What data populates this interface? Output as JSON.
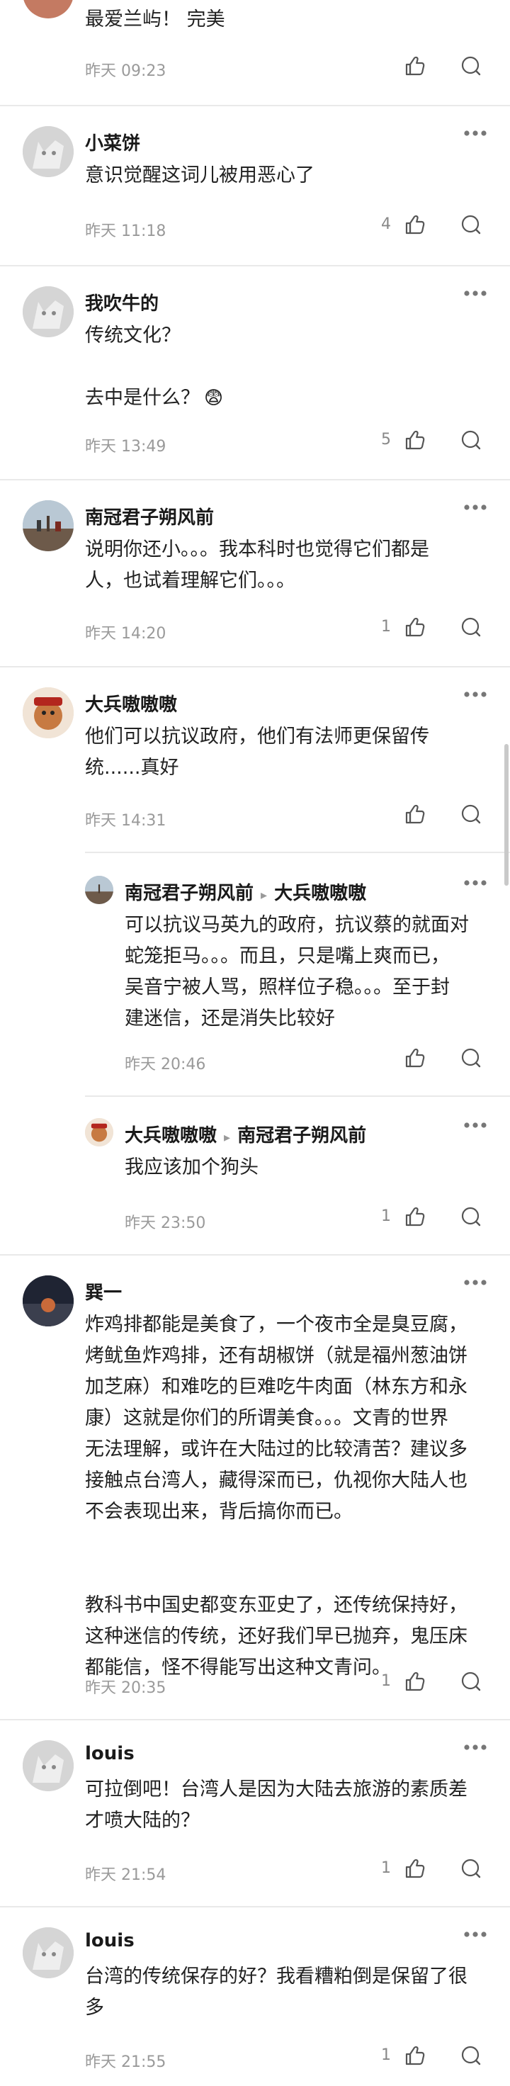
{
  "comments": [
    {
      "id": "c0",
      "user": "",
      "text": "最爱兰屿！ 完美",
      "time": "昨天 09:23",
      "likes": ""
    },
    {
      "id": "c1",
      "user": "小菜饼",
      "text": "意识觉醒这词儿被用恶心了",
      "time": "昨天 11:18",
      "likes": "4"
    },
    {
      "id": "c2",
      "user": "我吹牛的",
      "text": "传统文化？\n\n去中是什么？",
      "emoji": "😨",
      "time": "昨天 13:49",
      "likes": "5"
    },
    {
      "id": "c3",
      "user": "南冠君子朔风前",
      "text": "说明你还小。。。我本科时也觉得它们都是\n人，也试着理解它们。。。",
      "time": "昨天 14:20",
      "likes": "1"
    },
    {
      "id": "c4",
      "user": "大兵嗷嗷嗷",
      "text": "他们可以抗议政府，他们有法师更保留传\n统......真好",
      "time": "昨天 14:31",
      "likes": ""
    },
    {
      "id": "r1",
      "user": "南冠君子朔风前",
      "reply_to": "大兵嗷嗷嗷",
      "text": "可以抗议马英九的政府，抗议蔡的就面对\n蛇笼拒马。。。而且，只是嘴上爽而已，\n吴音宁被人骂，照样位子稳。。。至于封\n建迷信，还是消失比较好",
      "time": "昨天 20:46",
      "likes": ""
    },
    {
      "id": "r2",
      "user": "大兵嗷嗷嗷",
      "reply_to": "南冠君子朔风前",
      "text": "我应该加个狗头",
      "time": "昨天 23:50",
      "likes": "1"
    },
    {
      "id": "c5",
      "user": "巽一",
      "text": "炸鸡排都能是美食了，一个夜市全是臭豆腐，\n烤鱿鱼炸鸡排，还有胡椒饼（就是福州葱油饼\n加芝麻）和难吃的巨难吃牛肉面（林东方和永\n康）这就是你们的所谓美食。。。文青的世界\n无法理解，或许在大陆过的比较清苦？建议多\n接触点台湾人，藏得深而已，仇视你大陆人也\n不会表现出来，背后搞你而已。\n\n\n教科书中国史都变东亚史了，还传统保持好，\n这种迷信的传统，还好我们早已抛弃，鬼压床\n都能信，怪不得能写出这种文青问。",
      "time": "昨天 20:35",
      "likes": "1"
    },
    {
      "id": "c6",
      "user": "louis",
      "text": "可拉倒吧！台湾人是因为大陆去旅游的素质差\n才喷大陆的？",
      "time": "昨天 21:54",
      "likes": "1"
    },
    {
      "id": "c7",
      "user": "louis",
      "text": "台湾的传统保存的好？我看糟粕倒是保留了很\n多",
      "time": "昨天 21:55",
      "likes": "1"
    }
  ],
  "icons": {
    "like": "thumbs-up-icon",
    "reply": "comment-bubble-icon",
    "more": "more-dots-icon"
  },
  "colors": {
    "text": "#222222",
    "meta": "#9a9a9a",
    "divider": "#e9e9e9"
  }
}
